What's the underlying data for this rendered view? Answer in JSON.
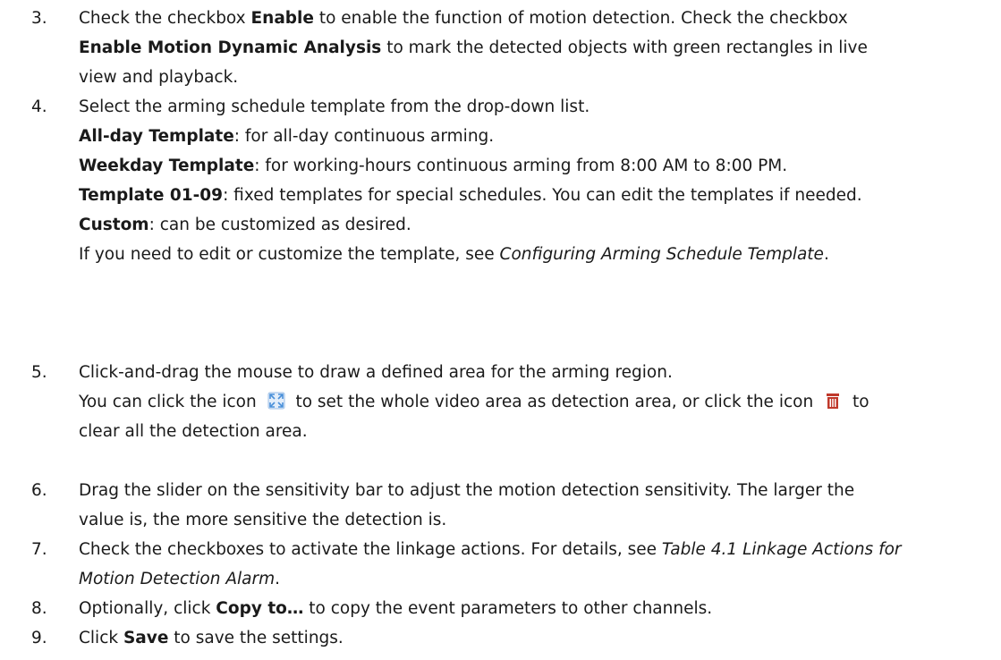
{
  "steps": [
    {
      "number": "3.",
      "lines": [
        [
          [
            "Check the checkbox ",
            ""
          ],
          [
            "Enable",
            "b"
          ],
          [
            " to enable the function of motion detection. Check the checkbox",
            ""
          ]
        ],
        [
          [
            "Enable Motion Dynamic Analysis",
            "b"
          ],
          [
            " to mark the detected objects with green rectangles in live",
            ""
          ]
        ],
        [
          [
            "view and playback.",
            ""
          ]
        ]
      ]
    },
    {
      "number": "4.",
      "lines": [
        [
          [
            "Select the arming schedule template from the drop-down list.",
            ""
          ]
        ],
        [
          [
            "All-day Template",
            "b"
          ],
          [
            ": for all-day continuous arming.",
            ""
          ]
        ],
        [
          [
            "Weekday Template",
            "b"
          ],
          [
            ": for working-hours continuous arming from 8:00 AM to 8:00 PM.",
            ""
          ]
        ],
        [
          [
            "Template 01-09",
            "b"
          ],
          [
            ": fixed templates for special schedules. You can edit the templates if needed.",
            ""
          ]
        ],
        [
          [
            "Custom",
            "b"
          ],
          [
            ": can be customized as desired.",
            ""
          ]
        ],
        [
          [
            "If you need to edit or customize the template, see ",
            ""
          ],
          [
            "Configuring Arming Schedule Template",
            "i"
          ],
          [
            ".",
            ""
          ]
        ]
      ]
    },
    {
      "number": "5.",
      "lines": [
        [
          [
            "Click-and-drag the mouse to draw a defined area for the arming region.",
            ""
          ]
        ],
        [
          [
            "You can click the icon ",
            ""
          ],
          [
            "fullscreen-area-icon",
            "icon"
          ],
          [
            " to set the whole video area as detection area, or click the icon ",
            ""
          ],
          [
            "trash-icon",
            "icon"
          ],
          [
            " to",
            ""
          ]
        ],
        [
          [
            "clear all the detection area.",
            ""
          ]
        ]
      ]
    },
    {
      "number": "6.",
      "lines": [
        [
          [
            "Drag the slider on the sensitivity bar to adjust the motion detection sensitivity. The larger the",
            ""
          ]
        ],
        [
          [
            "value is, the more sensitive the detection is.",
            ""
          ]
        ]
      ]
    },
    {
      "number": "7.",
      "lines": [
        [
          [
            "Check the checkboxes to activate the linkage actions. For details, see ",
            ""
          ],
          [
            "Table 4.1 Linkage Actions for",
            "i"
          ]
        ],
        [
          [
            "Motion Detection Alarm",
            "i"
          ],
          [
            ".",
            ""
          ]
        ]
      ]
    },
    {
      "number": "8.",
      "lines": [
        [
          [
            "Optionally, click ",
            ""
          ],
          [
            "Copy to…",
            "b"
          ],
          [
            " to copy the event parameters to other channels.",
            ""
          ]
        ]
      ]
    },
    {
      "number": "9.",
      "lines": [
        [
          [
            "Click ",
            ""
          ],
          [
            "Save",
            "b"
          ],
          [
            " to save the settings.",
            ""
          ]
        ]
      ]
    }
  ],
  "icons": {
    "fullscreen-area-icon": {
      "color": "#4a90d9"
    },
    "trash-icon": {
      "color": "#c0392b"
    }
  }
}
